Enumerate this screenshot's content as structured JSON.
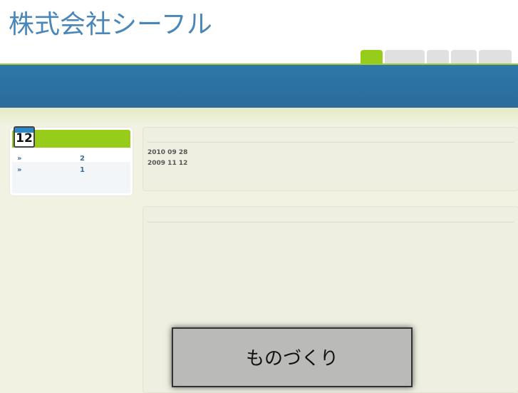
{
  "site": {
    "title": "株式会社シーフル"
  },
  "sidebar": {
    "calendar_icon_day": "12",
    "items": [
      {
        "bullet": "»",
        "count": "2"
      },
      {
        "bullet": "»",
        "count": "1"
      }
    ]
  },
  "archive": {
    "dates": [
      "2010  09  28",
      "2009  11  12"
    ]
  },
  "button": {
    "label": "ものづくり"
  }
}
